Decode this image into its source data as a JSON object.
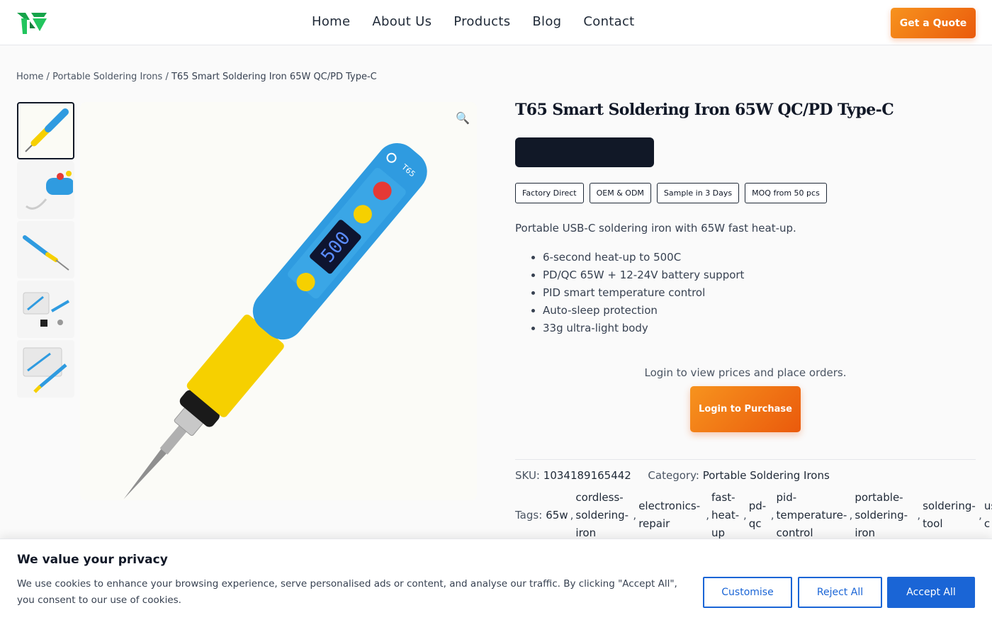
{
  "header": {
    "logo_icon": "brand-logo-icon",
    "nav": [
      "Home",
      "About Us",
      "Products",
      "Blog",
      "Contact"
    ],
    "quote_label": "Get a Quote"
  },
  "breadcrumb": {
    "home": "Home",
    "sep": "/",
    "category": "Portable Soldering Irons",
    "current": "T65 Smart Soldering Iron 65W QC/PD Type-C"
  },
  "product": {
    "title": "T65 Smart Soldering Iron 65W QC/PD Type-C",
    "badges": [
      "Factory Direct",
      "OEM & ODM",
      "Sample in 3 Days",
      "MOQ from 50 pcs"
    ],
    "description": "Portable USB-C soldering iron with 65W fast heat-up.",
    "features": [
      "6-second heat-up to 500C",
      "PD/QC 65W + 12-24V battery support",
      "PID smart temperature control",
      "Auto-sleep protection",
      "33g ultra-light body"
    ],
    "login_note": "Login to view prices and place orders.",
    "purchase_label": "Login to Purchase",
    "sku_label": "SKU:",
    "sku": "1034189165442",
    "category_label": "Category:",
    "category": "Portable Soldering Irons",
    "tags_label": "Tags:",
    "tags": [
      "65w",
      "cordless-soldering-iron",
      "electronics-repair",
      "fast-heat-up",
      "pd-qc",
      "pid-temperature-control",
      "portable-soldering-iron",
      "soldering-tool",
      "usb-c"
    ],
    "display_reading": "500",
    "body_mark": "T65"
  },
  "cookie": {
    "title": "We value your privacy",
    "text": "We use cookies to enhance your browsing experience, serve personalised ads or content, and analyse our traffic. By clicking \"Accept All\", you consent to our use of cookies.",
    "customise": "Customise",
    "reject": "Reject All",
    "accept": "Accept All"
  },
  "colors": {
    "accent_orange": "#f7931e",
    "accent_blue": "#1a65d6",
    "dark": "#111827"
  }
}
